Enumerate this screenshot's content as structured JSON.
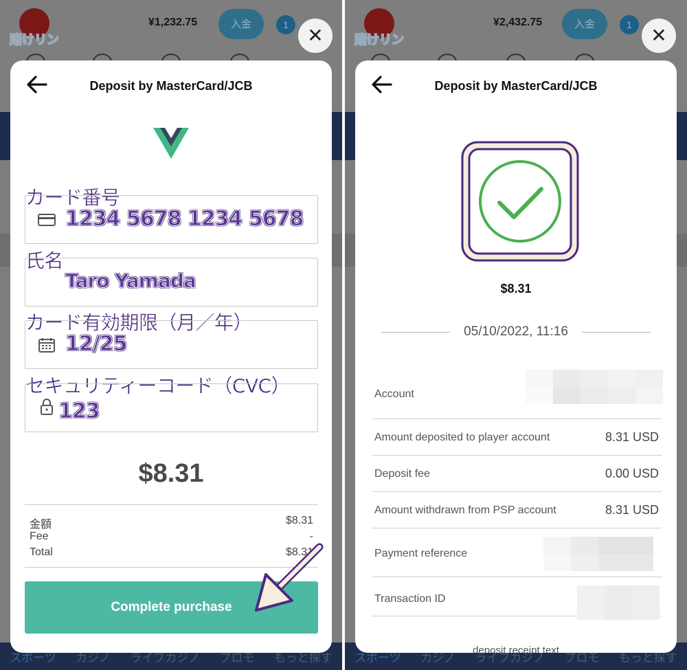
{
  "left": {
    "header": {
      "balance": "¥1,232.75",
      "deposit_label": "入金",
      "notification_count": "1"
    },
    "bottom_nav": [
      "スポーツ",
      "カジノ",
      "ライブカジノ",
      "プロモ",
      "もっと探す"
    ],
    "modal": {
      "title": "Deposit by MasterCard/JCB",
      "fields": [
        {
          "label": "カード番号",
          "value": "1234 5678 1234 5678",
          "icon": "credit-card-icon"
        },
        {
          "label": "氏名",
          "value": "Taro Yamada",
          "icon": "none"
        },
        {
          "label": "カード有効期限（月／年）",
          "value": "12/25",
          "icon": "calendar-icon"
        },
        {
          "label": "セキュリティーコード（CVC）",
          "value": "123",
          "icon": "lock-icon"
        }
      ],
      "amount": "$8.31",
      "summary": [
        {
          "label": "金額",
          "value": "$8.31"
        },
        {
          "label": "Fee",
          "value": "-"
        },
        {
          "label": "Total",
          "value": "$8.31"
        }
      ],
      "submit_label": "Complete purchase"
    }
  },
  "right": {
    "header": {
      "balance": "¥2,432.75",
      "deposit_label": "入金",
      "notification_count": "1"
    },
    "bottom_nav": [
      "スポーツ",
      "カジノ",
      "ライブカジノ",
      "プロモ",
      "もっと探す"
    ],
    "modal": {
      "title": "Deposit by MasterCard/JCB",
      "amount": "$8.31",
      "datetime": "05/10/2022, 11:16",
      "rows": [
        {
          "label": "Account",
          "value": ""
        },
        {
          "label": "Amount deposited to player account",
          "value": "8.31 USD"
        },
        {
          "label": "Deposit fee",
          "value": "0.00 USD"
        },
        {
          "label": "Amount withdrawn from PSP account",
          "value": "8.31 USD"
        },
        {
          "label": "Payment reference",
          "value": ""
        },
        {
          "label": "Transaction ID",
          "value": ""
        }
      ],
      "footer_text": "deposit receipt text"
    }
  },
  "colors": {
    "accent_teal": "#4db9a3",
    "annotation_purple": "#5a3596",
    "success_green": "#4caf50"
  }
}
